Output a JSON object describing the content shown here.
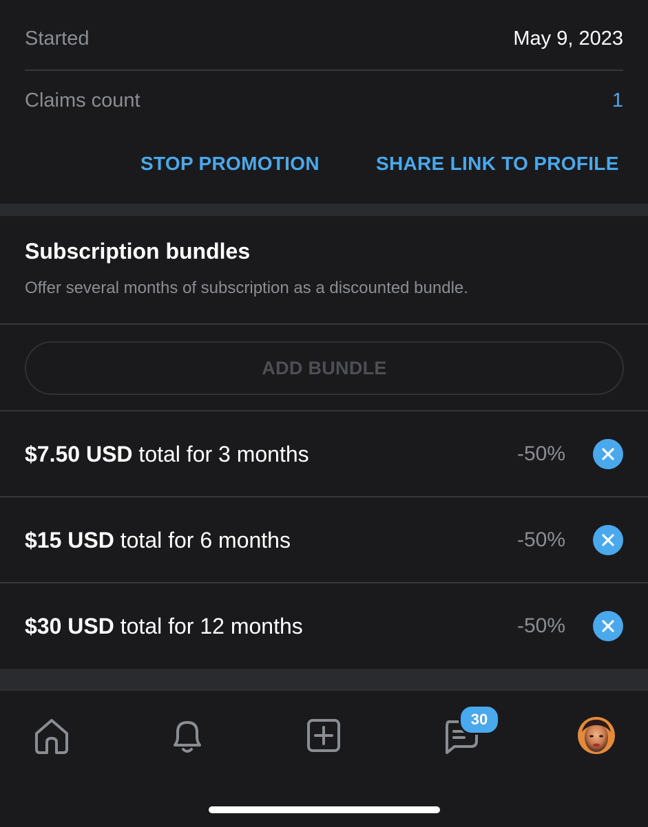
{
  "promotion": {
    "started_label": "Started",
    "started_value": "May 9, 2023",
    "claims_label": "Claims count",
    "claims_value": "1",
    "stop_label": "STOP PROMOTION",
    "share_label": "SHARE LINK TO PROFILE"
  },
  "bundles": {
    "title": "Subscription bundles",
    "description": "Offer several months of subscription as a discounted bundle.",
    "add_label": "ADD BUNDLE",
    "items": [
      {
        "price": "$7.50 USD",
        "term": " total for 3 months",
        "discount": "-50%"
      },
      {
        "price": "$15 USD",
        "term": " total for 6 months",
        "discount": "-50%"
      },
      {
        "price": "$30 USD",
        "term": " total for 12 months",
        "discount": "-50%"
      }
    ]
  },
  "nav": {
    "items": [
      "home-icon",
      "bell-icon",
      "add-post-icon",
      "messages-icon",
      "avatar"
    ],
    "messages_badge": "30"
  },
  "colors": {
    "background": "#1a1a1c",
    "accent": "#4aa8ec",
    "muted_text": "#8a8d93",
    "divider": "#36373b"
  }
}
